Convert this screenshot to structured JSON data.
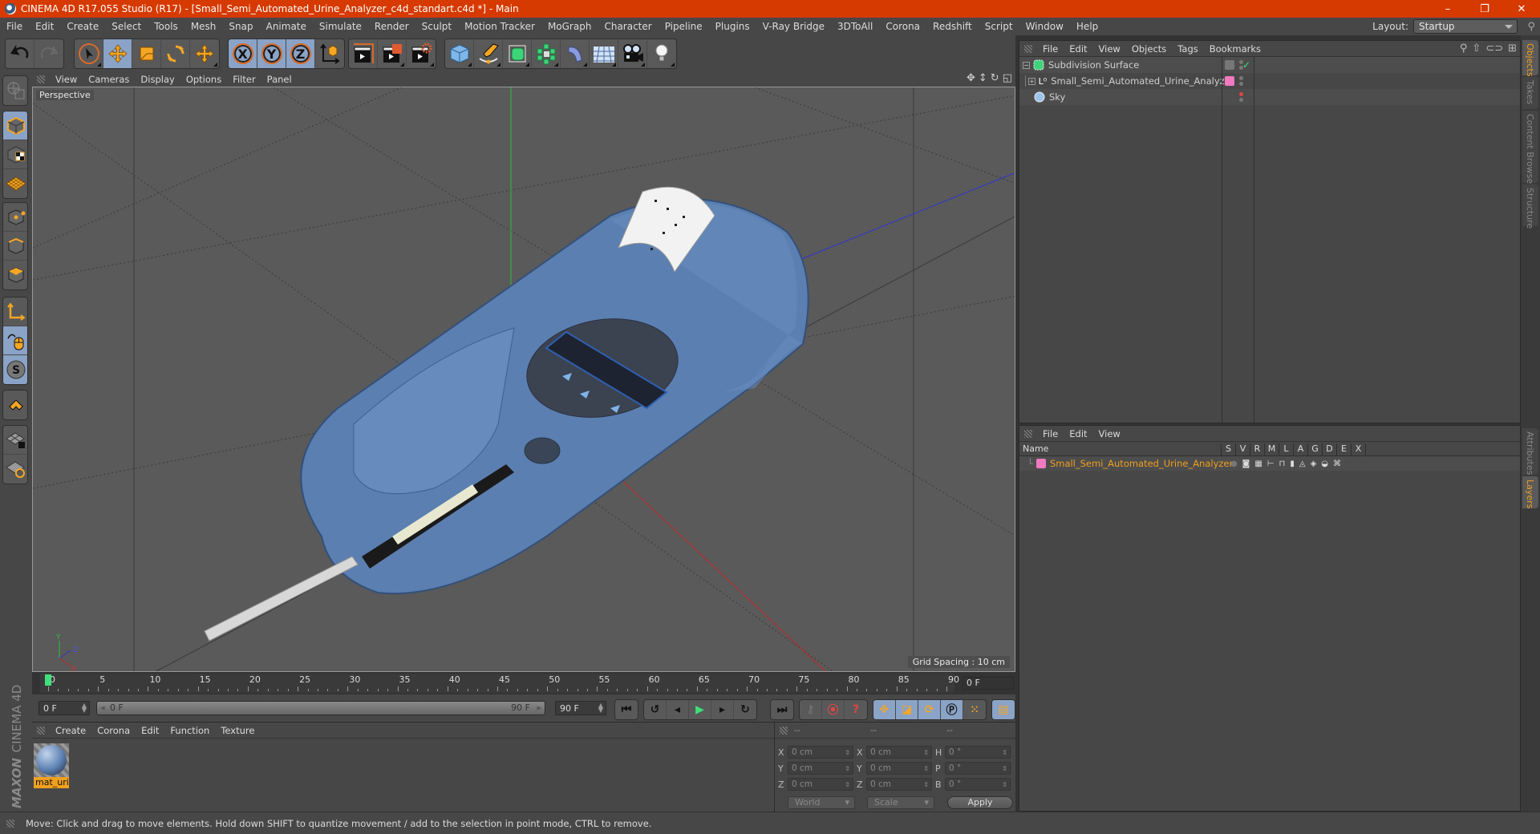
{
  "window": {
    "title": "CINEMA 4D R17.055 Studio (R17) - [Small_Semi_Automated_Urine_Analyzer_c4d_standart.c4d *] - Main",
    "controls": [
      "–",
      "❐",
      "✕"
    ]
  },
  "menubar": {
    "items": [
      "File",
      "Edit",
      "Create",
      "Select",
      "Tools",
      "Mesh",
      "Snap",
      "Animate",
      "Simulate",
      "Render",
      "Sculpt",
      "Motion Tracker",
      "MoGraph",
      "Character",
      "Pipeline",
      "Plugins",
      "V-Ray Bridge",
      "3DToAll",
      "Corona",
      "Redshift",
      "Script",
      "Window",
      "Help"
    ],
    "layout_label": "Layout:",
    "layout_value": "Startup"
  },
  "toolbar": {
    "axis_labels": [
      "X",
      "Y",
      "Z"
    ]
  },
  "viewport": {
    "menu": [
      "View",
      "Cameras",
      "Display",
      "Options",
      "Filter",
      "Panel"
    ],
    "camera_label": "Perspective",
    "grid_spacing": "Grid Spacing : 10 cm",
    "axis_gizmo": {
      "x": "X",
      "y": "Y",
      "z": "Z"
    },
    "colors": {
      "x_axis": "#c0282a",
      "y_axis": "#2fbf3a",
      "z_axis": "#3434d0",
      "model_blue": "#5b7fb0"
    }
  },
  "timeline": {
    "ticks": [
      "0",
      "5",
      "10",
      "15",
      "20",
      "25",
      "30",
      "35",
      "40",
      "45",
      "50",
      "55",
      "60",
      "65",
      "70",
      "75",
      "80",
      "85",
      "90"
    ],
    "current_frame_field": "0 F",
    "start_field": "0 F",
    "range_start": "0 F",
    "range_end": "90 F",
    "end_field": "90 F",
    "playhead_frame": 0,
    "max_frame": 90
  },
  "material_manager": {
    "menu": [
      "Create",
      "Corona",
      "Edit",
      "Function",
      "Texture"
    ],
    "materials": [
      {
        "name": "mat_urir"
      }
    ]
  },
  "coordinates": {
    "headers": [
      "--",
      "--",
      "--"
    ],
    "rows": [
      {
        "a1": "X",
        "v1": "0 cm",
        "a2": "X",
        "v2": "0 cm",
        "a3": "H",
        "v3": "0 °"
      },
      {
        "a1": "Y",
        "v1": "0 cm",
        "a2": "Y",
        "v2": "0 cm",
        "a3": "P",
        "v3": "0 °"
      },
      {
        "a1": "Z",
        "v1": "0 cm",
        "a2": "Z",
        "v2": "0 cm",
        "a3": "B",
        "v3": "0 °"
      }
    ],
    "space_dropdown": "World",
    "mode_dropdown": "Scale",
    "apply_label": "Apply"
  },
  "object_manager": {
    "menu": [
      "File",
      "Edit",
      "View",
      "Objects",
      "Tags",
      "Bookmarks"
    ],
    "objects": [
      {
        "name": "Subdivision Surface",
        "expander": "−",
        "indent": 0
      },
      {
        "name": "Small_Semi_Automated_Urine_Analyzer",
        "expander": "+",
        "indent": 1
      },
      {
        "name": "Sky",
        "expander": "",
        "indent": 0
      }
    ]
  },
  "layer_manager": {
    "menu": [
      "File",
      "Edit",
      "View"
    ],
    "columns": [
      "Name",
      "S",
      "V",
      "R",
      "M",
      "L",
      "A",
      "G",
      "D",
      "E",
      "X"
    ],
    "layers": [
      {
        "name": "Small_Semi_Automated_Urine_Analyzer",
        "color": "#f07ac0"
      }
    ]
  },
  "side_tabs": {
    "top": [
      "Objects",
      "Takes",
      "Content Browser",
      "Structure"
    ],
    "bottom": [
      "Attributes",
      "Layers"
    ]
  },
  "branding": {
    "maxon": "MAXON",
    "product": "CINEMA 4D"
  },
  "statusbar": {
    "text": "Move: Click and drag to move elements. Hold down SHIFT to quantize movement / add to the selection in point mode, CTRL to remove."
  }
}
